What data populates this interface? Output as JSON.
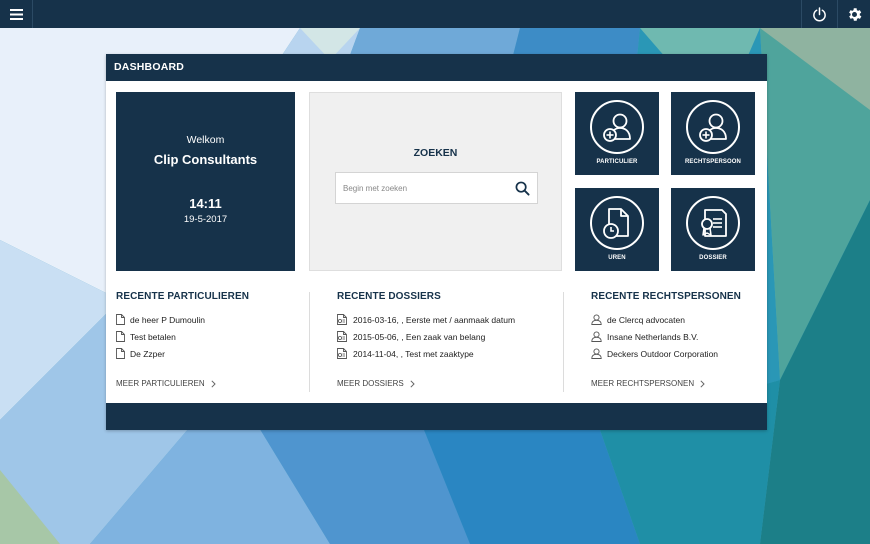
{
  "topbar": {
    "icons": [
      "menu-icon",
      "power-icon",
      "gear-icon"
    ]
  },
  "dashboard": {
    "title": "DASHBOARD"
  },
  "welcome": {
    "greeting": "Welkom",
    "company": "Clip Consultants",
    "time": "14:11",
    "date": "19-5-2017"
  },
  "search": {
    "title": "ZOEKEN",
    "placeholder": "Begin met zoeken",
    "value": ""
  },
  "tiles": [
    {
      "label": "PARTICULIER",
      "icon": "add-person-icon"
    },
    {
      "label": "RECHTSPERSOON",
      "icon": "add-person-icon"
    },
    {
      "label": "UREN",
      "icon": "document-clock-icon"
    },
    {
      "label": "DOSSIER",
      "icon": "document-badge-icon"
    }
  ],
  "recent_particulieren": {
    "title": "RECENTE PARTICULIEREN",
    "items": [
      "de heer P Dumoulin",
      "Test betalen",
      "De Zzper"
    ],
    "more": "MEER PARTICULIEREN"
  },
  "recent_dossiers": {
    "title": "RECENTE DOSSIERS",
    "items": [
      "2016-03-16, , Eerste met / aanmaak datum",
      "2015-05-06, , Een zaak van belang",
      "2014-11-04, , Test met zaaktype"
    ],
    "more": "MEER DOSSIERS"
  },
  "recent_rechtspersonen": {
    "title": "RECENTE RECHTSPERSONEN",
    "items": [
      "de Clercq advocaten",
      "Insane Netherlands B.V.",
      "Deckers Outdoor Corporation"
    ],
    "more": "MEER RECHTSPERSONEN"
  },
  "colors": {
    "navy": "#16324a",
    "panel": "#ffffff",
    "search_bg": "#f0f0f0"
  }
}
